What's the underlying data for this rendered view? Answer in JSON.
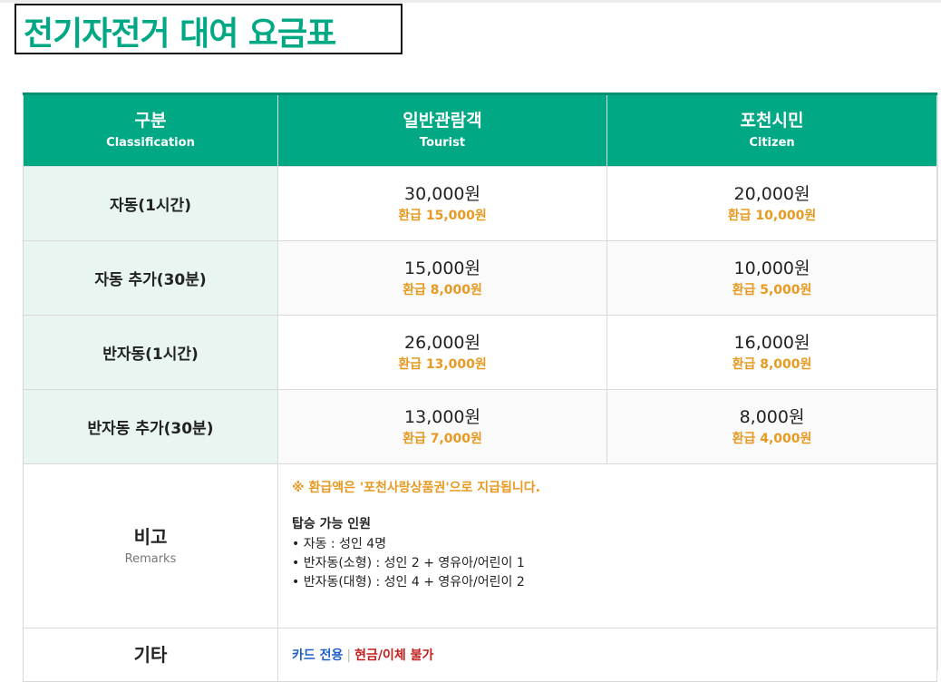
{
  "title": "전기자전거 대여 요금표",
  "colors": {
    "accent": "#00a884",
    "refund": "#e79a22",
    "card": "#1f5fc8",
    "cash": "#c41e1e",
    "category_bg": "#e8f5f1"
  },
  "header": {
    "classification": {
      "ko": "구분",
      "en": "Classification"
    },
    "tourist": {
      "ko": "일반관람객",
      "en": "Tourist"
    },
    "citizen": {
      "ko": "포천시민",
      "en": "Citizen"
    }
  },
  "rows": [
    {
      "category": "자동(1시간)",
      "tourist_price": "30,000원",
      "tourist_refund": "환급 15,000원",
      "citizen_price": "20,000원",
      "citizen_refund": "환급 10,000원"
    },
    {
      "category": "자동 추가(30분)",
      "tourist_price": "15,000원",
      "tourist_refund": "환급 8,000원",
      "citizen_price": "10,000원",
      "citizen_refund": "환급 5,000원"
    },
    {
      "category": "반자동(1시간)",
      "tourist_price": "26,000원",
      "tourist_refund": "환급 13,000원",
      "citizen_price": "16,000원",
      "citizen_refund": "환급 8,000원"
    },
    {
      "category": "반자동 추가(30분)",
      "tourist_price": "13,000원",
      "tourist_refund": "환급 7,000원",
      "citizen_price": "8,000원",
      "citizen_refund": "환급 4,000원"
    }
  ],
  "remarks": {
    "label_ko": "비고",
    "label_en": "Remarks",
    "refund_note": "※ 환급액은 '포천사랑상품권'으로 지급됩니다.",
    "capacity_title": "탑승 가능 인원",
    "capacity": [
      "• 자동 : 성인 4명",
      "• 반자동(소형) : 성인 2 + 영유아/어린이 1",
      "• 반자동(대형) : 성인 4 + 영유아/어린이 2"
    ]
  },
  "misc": {
    "label": "기타",
    "card_only": "카드 전용",
    "separator": "|",
    "no_cash": "현금/이체 불가"
  }
}
